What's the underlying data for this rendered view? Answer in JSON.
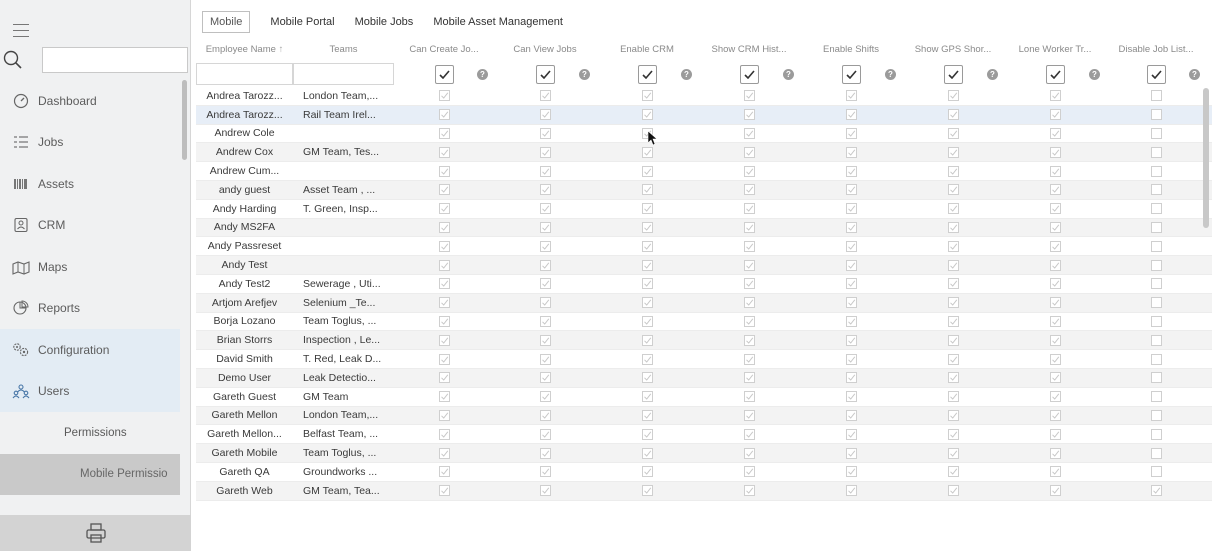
{
  "sidebar": {
    "search_placeholder": "",
    "items": [
      {
        "label": "Dashboard",
        "icon": "dashboard-icon"
      },
      {
        "label": "Jobs",
        "icon": "jobs-icon"
      },
      {
        "label": "Assets",
        "icon": "assets-icon"
      },
      {
        "label": "CRM",
        "icon": "crm-icon"
      },
      {
        "label": "Maps",
        "icon": "maps-icon"
      },
      {
        "label": "Reports",
        "icon": "reports-icon"
      },
      {
        "label": "Configuration",
        "icon": "configuration-icon"
      },
      {
        "label": "Users",
        "icon": "users-icon"
      }
    ],
    "sub_items": [
      {
        "label": "Permissions"
      },
      {
        "label": "Mobile Permissio"
      }
    ]
  },
  "tabs": [
    "Mobile",
    "Mobile Portal",
    "Mobile Jobs",
    "Mobile Asset Management"
  ],
  "columns": {
    "name": "Employee Name",
    "teams": "Teams",
    "perms": [
      "Can Create Jo...",
      "Can View Jobs",
      "Enable CRM",
      "Show CRM Hist...",
      "Enable Shifts",
      "Show GPS Shor...",
      "Lone Worker Tr...",
      "Disable Job List..."
    ]
  },
  "rows": [
    {
      "name": "Andrea Tarozz...",
      "teams": "London Team,..."
    },
    {
      "name": "Andrea Tarozz...",
      "teams": "Rail Team Irel..."
    },
    {
      "name": "Andrew Cole",
      "teams": ""
    },
    {
      "name": "Andrew Cox",
      "teams": "GM Team, Tes..."
    },
    {
      "name": "Andrew Cum...",
      "teams": ""
    },
    {
      "name": "andy guest",
      "teams": "Asset Team , ..."
    },
    {
      "name": "Andy Harding",
      "teams": "T. Green, Insp..."
    },
    {
      "name": "Andy MS2FA",
      "teams": ""
    },
    {
      "name": "Andy Passreset",
      "teams": ""
    },
    {
      "name": "Andy Test",
      "teams": ""
    },
    {
      "name": "Andy Test2",
      "teams": "Sewerage , Uti..."
    },
    {
      "name": "Artjom Arefjev",
      "teams": "Selenium _Te..."
    },
    {
      "name": "Borja Lozano",
      "teams": "Team Toglus, ..."
    },
    {
      "name": "Brian Storrs",
      "teams": "Inspection , Le..."
    },
    {
      "name": "David Smith",
      "teams": "T. Red, Leak D..."
    },
    {
      "name": "Demo User",
      "teams": "Leak Detectio..."
    },
    {
      "name": "Gareth Guest",
      "teams": "GM Team"
    },
    {
      "name": "Gareth Mellon",
      "teams": "London Team,..."
    },
    {
      "name": "Gareth Mellon...",
      "teams": "Belfast Team, ..."
    },
    {
      "name": "Gareth Mobile",
      "teams": "Team Toglus, ..."
    },
    {
      "name": "Gareth QA",
      "teams": "Groundworks ..."
    },
    {
      "name": "Gareth Web",
      "teams": "GM Team, Tea..."
    }
  ]
}
